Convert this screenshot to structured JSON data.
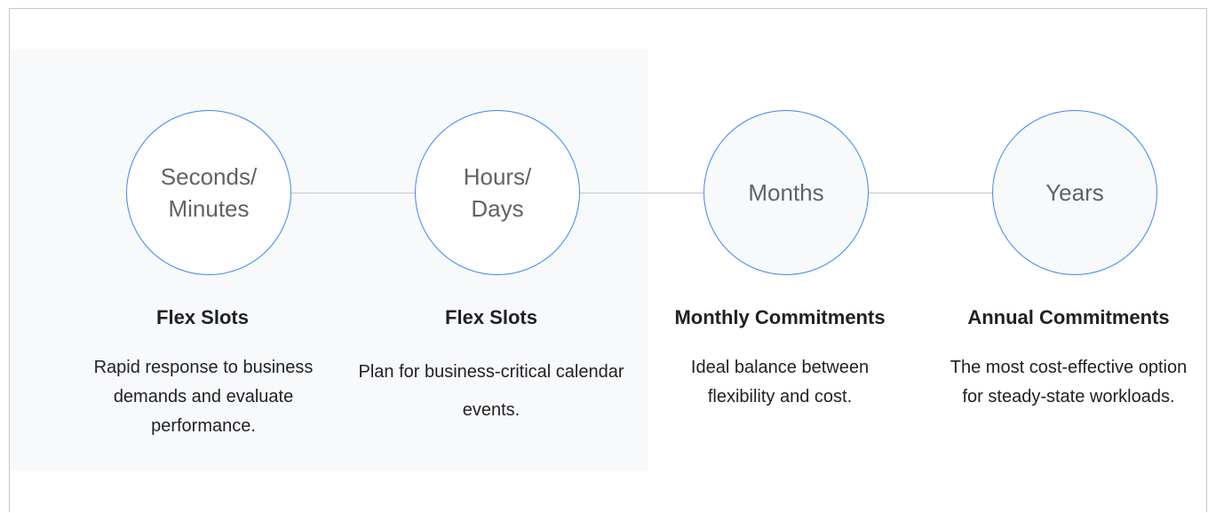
{
  "stages": [
    {
      "circle_lines": [
        "Seconds/",
        "Minutes"
      ],
      "title": "Flex Slots",
      "description": "Rapid response to business demands and evaluate performance."
    },
    {
      "circle_lines": [
        "Hours/",
        "Days"
      ],
      "title": "Flex Slots",
      "description": "Plan for business-critical calendar events."
    },
    {
      "circle_lines": [
        "Months"
      ],
      "title": "Monthly Commitments",
      "description": "Ideal balance between flexibility and cost."
    },
    {
      "circle_lines": [
        "Years"
      ],
      "title": "Annual Commitments",
      "description": "The most cost-effective option for steady-state workloads."
    }
  ],
  "colors": {
    "circle_border": "#4285f4",
    "highlight_background": "#f8f9fa",
    "connector": "#c4c7c9",
    "circle_text": "#5f6368"
  }
}
